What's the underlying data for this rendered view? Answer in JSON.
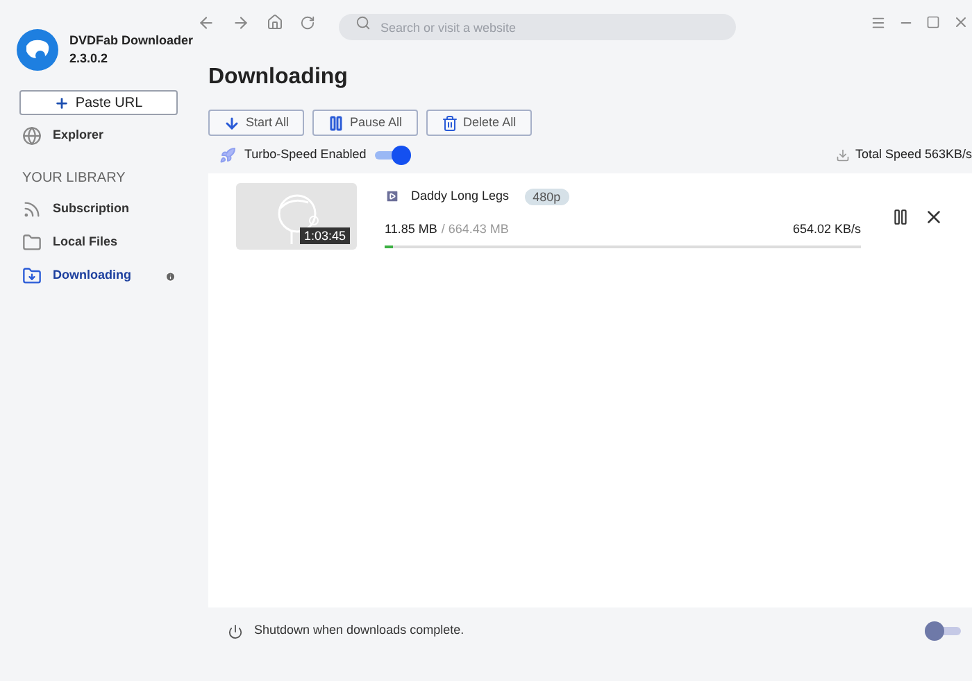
{
  "app": {
    "name": "DVDFab Downloader",
    "version": "2.3.0.2"
  },
  "sidebar": {
    "paste_button": "Paste URL",
    "top_items": [
      {
        "label": "Explorer",
        "kind": "globe",
        "selected": false
      }
    ],
    "section_title": "YOUR LIBRARY",
    "items": [
      {
        "label": "Subscription",
        "kind": "rss",
        "selected": false,
        "badge": false
      },
      {
        "label": "Local Files",
        "kind": "folder",
        "selected": false,
        "badge": false
      },
      {
        "label": "Downloading",
        "kind": "download",
        "selected": true,
        "badge": true
      }
    ]
  },
  "search": {
    "placeholder": "Search or visit a website"
  },
  "page_title": "Downloading",
  "actions": [
    {
      "label": "Start All",
      "kind": "start"
    },
    {
      "label": "Pause All",
      "kind": "pause"
    },
    {
      "label": "Delete All",
      "kind": "delete"
    }
  ],
  "turbo": {
    "label": "Turbo-Speed Enabled",
    "on": true
  },
  "total_speed": "Total Speed 563KB/s",
  "downloads": [
    {
      "duration": "1:03:45",
      "title": "Daddy Long Legs",
      "quality": "480p",
      "downloaded": "11.85 MB",
      "total": "/ 664.43 MB",
      "speed": "654.02 KB/s",
      "level": 0.018
    }
  ],
  "shutdown": {
    "label": "Shutdown when downloads complete.",
    "on": false
  }
}
